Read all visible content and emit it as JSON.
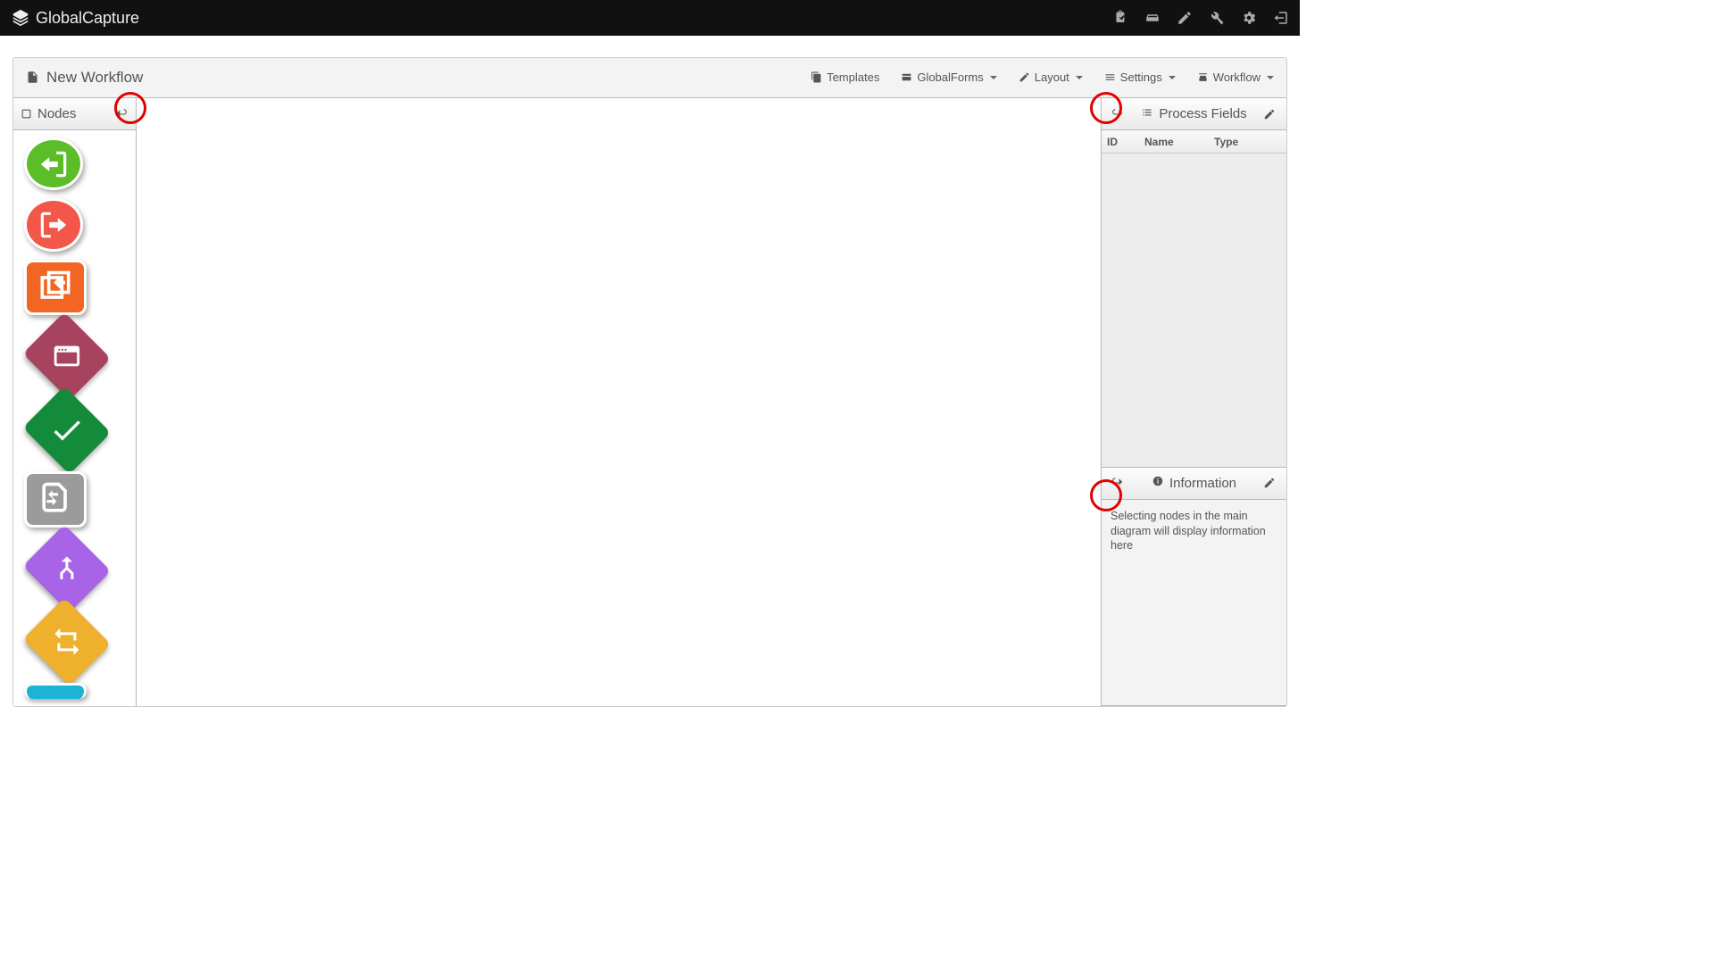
{
  "app": {
    "name": "GlobalCapture"
  },
  "page_title": "New Workflow",
  "menus": {
    "templates": "Templates",
    "globalforms": "GlobalForms",
    "layout": "Layout",
    "settings": "Settings",
    "workflow": "Workflow"
  },
  "panels": {
    "nodes_title": "Nodes",
    "process_fields_title": "Process Fields",
    "fields_columns": {
      "id": "ID",
      "name": "Name",
      "type": "Type"
    },
    "info_title": "Information",
    "info_hint": "Selecting nodes in the main diagram will display information here"
  },
  "node_types": [
    {
      "id": "import",
      "shape": "circle",
      "color": "green"
    },
    {
      "id": "export",
      "shape": "circle",
      "color": "red"
    },
    {
      "id": "template",
      "shape": "square",
      "color": "orange"
    },
    {
      "id": "app-window",
      "shape": "diamond",
      "color": "maroon"
    },
    {
      "id": "validate",
      "shape": "diamond",
      "color": "dgreen"
    },
    {
      "id": "transform",
      "shape": "square",
      "color": "gray"
    },
    {
      "id": "split",
      "shape": "diamond",
      "color": "purple"
    },
    {
      "id": "loop",
      "shape": "diamond",
      "color": "yellow"
    },
    {
      "id": "process",
      "shape": "square",
      "color": "cyan"
    }
  ]
}
